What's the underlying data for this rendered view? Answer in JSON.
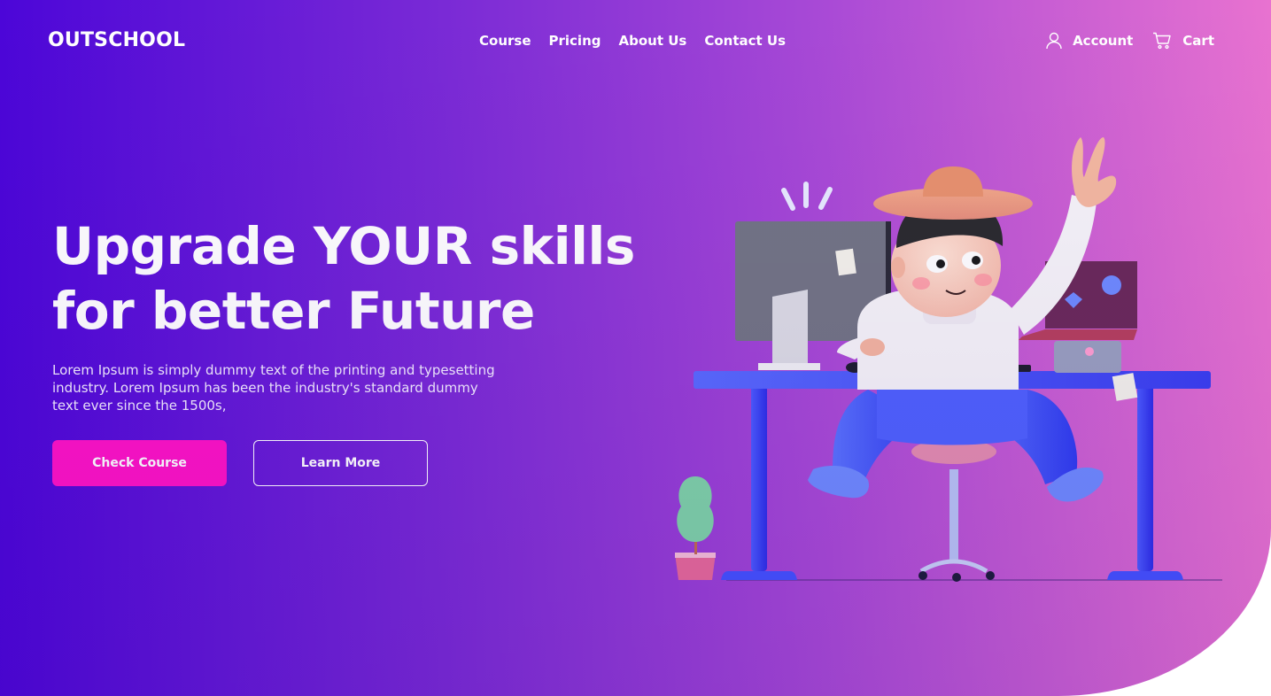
{
  "brand": {
    "logo": "OUTSCHOOL"
  },
  "nav": {
    "links": [
      "Course",
      "Pricing",
      "About Us",
      "Contact Us"
    ],
    "account_label": "Account",
    "cart_label": "Cart"
  },
  "hero": {
    "title_line1": "Upgrade YOUR skills",
    "title_line2": "for better Future",
    "subtitle": "Lorem Ipsum is simply dummy text of the printing and typesetting industry. Lorem Ipsum has been the industry's standard dummy text ever since the 1500s,",
    "primary_button": "Check Course",
    "secondary_button": "Learn More"
  },
  "icons": [
    "user-icon",
    "cart-icon"
  ],
  "colors": {
    "gradient_start": "#4c06d8",
    "gradient_end": "#e872d0",
    "primary_button": "#ff13c6",
    "text": "#ffffff"
  }
}
